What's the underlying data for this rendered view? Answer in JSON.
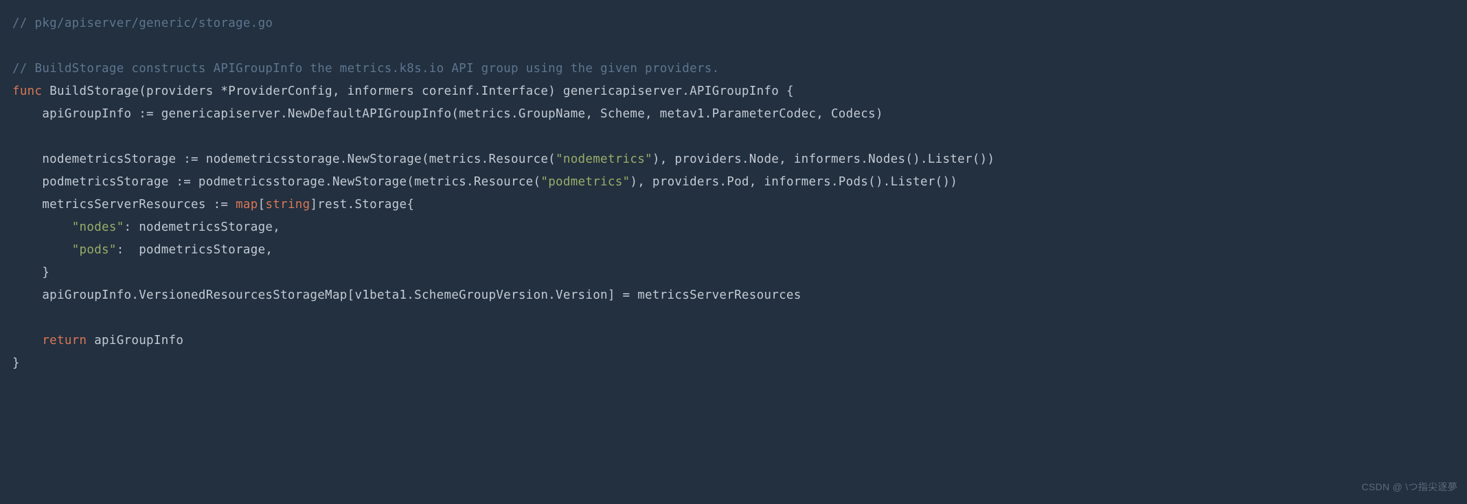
{
  "code": {
    "c1": "// pkg/apiserver/generic/storage.go",
    "c2": "// BuildStorage constructs APIGroupInfo the metrics.k8s.io API group using the given providers.",
    "kw_func": "func",
    "fn_name": "BuildStorage",
    "sig_open": "(providers *ProviderConfig, informers coreinf.Interface) genericapiserver.APIGroupInfo {",
    "l1": "    apiGroupInfo := genericapiserver.NewDefaultAPIGroupInfo(metrics.GroupName, Scheme, metav1.ParameterCodec, Codecs)",
    "l2a": "    nodemetricsStorage := nodemetricsstorage.NewStorage(metrics.Resource(",
    "l2s": "\"nodemetrics\"",
    "l2b": "), providers.Node, informers.Nodes().Lister())",
    "l3a": "    podmetricsStorage := podmetricsstorage.NewStorage(metrics.Resource(",
    "l3s": "\"podmetrics\"",
    "l3b": "), providers.Pod, informers.Pods().Lister())",
    "l4a": "    metricsServerResources := ",
    "kw_map": "map",
    "l4b": "[",
    "kw_string": "string",
    "l4c": "]rest.Storage{",
    "l5a": "        ",
    "l5s": "\"nodes\"",
    "l5b": ": nodemetricsStorage,",
    "l6a": "        ",
    "l6s": "\"pods\"",
    "l6b": ":  podmetricsStorage,",
    "l7": "    }",
    "l8": "    apiGroupInfo.VersionedResourcesStorageMap[v1beta1.SchemeGroupVersion.Version] = metricsServerResources",
    "kw_return": "return",
    "l9": " apiGroupInfo",
    "l10": "}"
  },
  "watermark": "CSDN @ \\つ指尖逐夢"
}
